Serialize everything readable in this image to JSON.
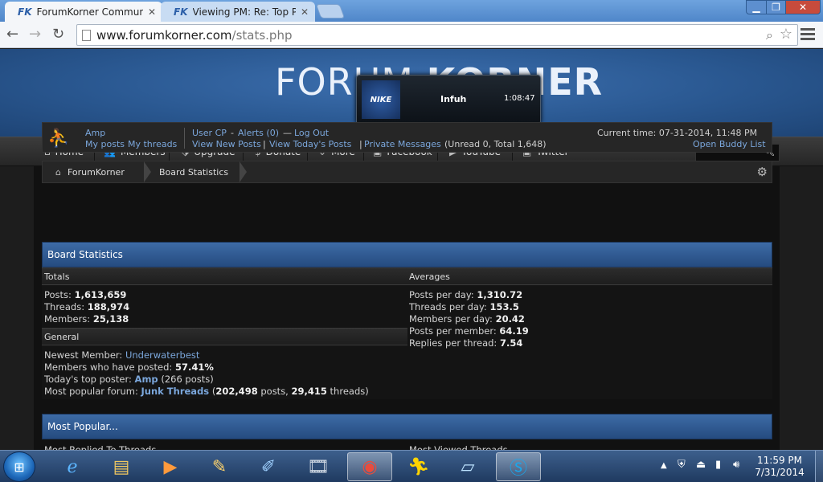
{
  "browser": {
    "tabs": [
      {
        "label": "ForumKorner Community",
        "favicon": "FK"
      },
      {
        "label": "Viewing PM: Re: Top Post",
        "favicon": "FK"
      }
    ],
    "url_host": "www.forumkorner.com",
    "url_path": "/stats.php"
  },
  "site": {
    "logo_light": "FORUM ",
    "logo_bold": "KORNER"
  },
  "notification": {
    "brand": "NIKE",
    "name": "Infuh",
    "time": "1:08:47"
  },
  "nav": {
    "items": [
      {
        "label": "Home",
        "icon": "home-icon"
      },
      {
        "label": "Members",
        "icon": "users-icon"
      },
      {
        "label": "Upgrade",
        "icon": "tag-icon"
      },
      {
        "label": "Donate",
        "icon": "dollar-icon"
      },
      {
        "label": "More",
        "icon": "chevron-down-icon"
      },
      {
        "label": "Facebook",
        "icon": "facebook-icon"
      },
      {
        "label": "YouTube",
        "icon": "play-icon"
      },
      {
        "label": "Twitter",
        "icon": "twitter-icon"
      }
    ]
  },
  "userbar": {
    "username": "Amp",
    "my_posts": "My posts",
    "my_threads": "My threads",
    "user_cp": "User CP",
    "dash1": "-",
    "alerts": "Alerts (0)",
    "dash2": "—",
    "logout": "Log Out",
    "view_new": "View New Posts",
    "pipe": "|",
    "view_today": "View Today's Posts",
    "private_messages": "Private Messages",
    "pm_counts": "(Unread 0, Total 1,648)",
    "current_time": "Current time: 07-31-2014, 11:48 PM",
    "buddy_list": "Open Buddy List"
  },
  "breadcrumb": {
    "home": "ForumKorner",
    "current": "Board Statistics"
  },
  "stats": {
    "panel_title": "Board Statistics",
    "totals_head": "Totals",
    "averages_head": "Averages",
    "general_head": "General",
    "posts_label": "Posts:",
    "posts": "1,613,659",
    "threads_label": "Threads:",
    "threads": "188,974",
    "members_label": "Members:",
    "members": "25,138",
    "ppd_label": "Posts per day:",
    "ppd": "1,310.72",
    "tpd_label": "Threads per day:",
    "tpd": "153.5",
    "mpd_label": "Members per day:",
    "mpd": "20.42",
    "ppm_label": "Posts per member:",
    "ppm": "64.19",
    "rpt_label": "Replies per thread:",
    "rpt": "7.54",
    "newest_label": "Newest Member:",
    "newest": "Underwaterbest",
    "posted_label": "Members who have posted:",
    "posted": "57.41%",
    "top_label": "Today's top poster:",
    "top_user": "Amp",
    "top_posts": "(266 posts)",
    "popular_label": "Most popular forum:",
    "popular_forum": "Junk Threads",
    "popular_counts_open": "(",
    "popular_posts": "202,498",
    "popular_posts_suffix": " posts, ",
    "popular_threads": "29,415",
    "popular_threads_suffix": " threads)",
    "most_popular": "Most Popular...",
    "most_replied": "Most Replied To Threads",
    "most_viewed": "Most Viewed Threads"
  },
  "taskbar": {
    "clock_time": "11:59 PM",
    "clock_date": "7/31/2014"
  }
}
